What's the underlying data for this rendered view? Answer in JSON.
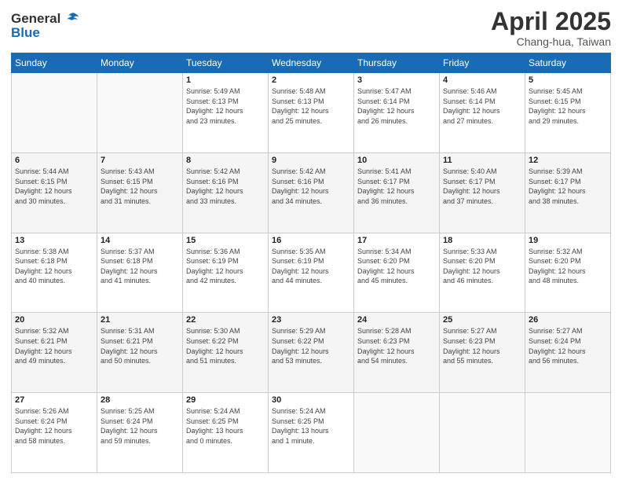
{
  "header": {
    "logo_line1": "General",
    "logo_line2": "Blue",
    "month_year": "April 2025",
    "location": "Chang-hua, Taiwan"
  },
  "weekdays": [
    "Sunday",
    "Monday",
    "Tuesday",
    "Wednesday",
    "Thursday",
    "Friday",
    "Saturday"
  ],
  "weeks": [
    [
      {
        "day": "",
        "info": ""
      },
      {
        "day": "",
        "info": ""
      },
      {
        "day": "1",
        "info": "Sunrise: 5:49 AM\nSunset: 6:13 PM\nDaylight: 12 hours\nand 23 minutes."
      },
      {
        "day": "2",
        "info": "Sunrise: 5:48 AM\nSunset: 6:13 PM\nDaylight: 12 hours\nand 25 minutes."
      },
      {
        "day": "3",
        "info": "Sunrise: 5:47 AM\nSunset: 6:14 PM\nDaylight: 12 hours\nand 26 minutes."
      },
      {
        "day": "4",
        "info": "Sunrise: 5:46 AM\nSunset: 6:14 PM\nDaylight: 12 hours\nand 27 minutes."
      },
      {
        "day": "5",
        "info": "Sunrise: 5:45 AM\nSunset: 6:15 PM\nDaylight: 12 hours\nand 29 minutes."
      }
    ],
    [
      {
        "day": "6",
        "info": "Sunrise: 5:44 AM\nSunset: 6:15 PM\nDaylight: 12 hours\nand 30 minutes."
      },
      {
        "day": "7",
        "info": "Sunrise: 5:43 AM\nSunset: 6:15 PM\nDaylight: 12 hours\nand 31 minutes."
      },
      {
        "day": "8",
        "info": "Sunrise: 5:42 AM\nSunset: 6:16 PM\nDaylight: 12 hours\nand 33 minutes."
      },
      {
        "day": "9",
        "info": "Sunrise: 5:42 AM\nSunset: 6:16 PM\nDaylight: 12 hours\nand 34 minutes."
      },
      {
        "day": "10",
        "info": "Sunrise: 5:41 AM\nSunset: 6:17 PM\nDaylight: 12 hours\nand 36 minutes."
      },
      {
        "day": "11",
        "info": "Sunrise: 5:40 AM\nSunset: 6:17 PM\nDaylight: 12 hours\nand 37 minutes."
      },
      {
        "day": "12",
        "info": "Sunrise: 5:39 AM\nSunset: 6:17 PM\nDaylight: 12 hours\nand 38 minutes."
      }
    ],
    [
      {
        "day": "13",
        "info": "Sunrise: 5:38 AM\nSunset: 6:18 PM\nDaylight: 12 hours\nand 40 minutes."
      },
      {
        "day": "14",
        "info": "Sunrise: 5:37 AM\nSunset: 6:18 PM\nDaylight: 12 hours\nand 41 minutes."
      },
      {
        "day": "15",
        "info": "Sunrise: 5:36 AM\nSunset: 6:19 PM\nDaylight: 12 hours\nand 42 minutes."
      },
      {
        "day": "16",
        "info": "Sunrise: 5:35 AM\nSunset: 6:19 PM\nDaylight: 12 hours\nand 44 minutes."
      },
      {
        "day": "17",
        "info": "Sunrise: 5:34 AM\nSunset: 6:20 PM\nDaylight: 12 hours\nand 45 minutes."
      },
      {
        "day": "18",
        "info": "Sunrise: 5:33 AM\nSunset: 6:20 PM\nDaylight: 12 hours\nand 46 minutes."
      },
      {
        "day": "19",
        "info": "Sunrise: 5:32 AM\nSunset: 6:20 PM\nDaylight: 12 hours\nand 48 minutes."
      }
    ],
    [
      {
        "day": "20",
        "info": "Sunrise: 5:32 AM\nSunset: 6:21 PM\nDaylight: 12 hours\nand 49 minutes."
      },
      {
        "day": "21",
        "info": "Sunrise: 5:31 AM\nSunset: 6:21 PM\nDaylight: 12 hours\nand 50 minutes."
      },
      {
        "day": "22",
        "info": "Sunrise: 5:30 AM\nSunset: 6:22 PM\nDaylight: 12 hours\nand 51 minutes."
      },
      {
        "day": "23",
        "info": "Sunrise: 5:29 AM\nSunset: 6:22 PM\nDaylight: 12 hours\nand 53 minutes."
      },
      {
        "day": "24",
        "info": "Sunrise: 5:28 AM\nSunset: 6:23 PM\nDaylight: 12 hours\nand 54 minutes."
      },
      {
        "day": "25",
        "info": "Sunrise: 5:27 AM\nSunset: 6:23 PM\nDaylight: 12 hours\nand 55 minutes."
      },
      {
        "day": "26",
        "info": "Sunrise: 5:27 AM\nSunset: 6:24 PM\nDaylight: 12 hours\nand 56 minutes."
      }
    ],
    [
      {
        "day": "27",
        "info": "Sunrise: 5:26 AM\nSunset: 6:24 PM\nDaylight: 12 hours\nand 58 minutes."
      },
      {
        "day": "28",
        "info": "Sunrise: 5:25 AM\nSunset: 6:24 PM\nDaylight: 12 hours\nand 59 minutes."
      },
      {
        "day": "29",
        "info": "Sunrise: 5:24 AM\nSunset: 6:25 PM\nDaylight: 13 hours\nand 0 minutes."
      },
      {
        "day": "30",
        "info": "Sunrise: 5:24 AM\nSunset: 6:25 PM\nDaylight: 13 hours\nand 1 minute."
      },
      {
        "day": "",
        "info": ""
      },
      {
        "day": "",
        "info": ""
      },
      {
        "day": "",
        "info": ""
      }
    ]
  ]
}
